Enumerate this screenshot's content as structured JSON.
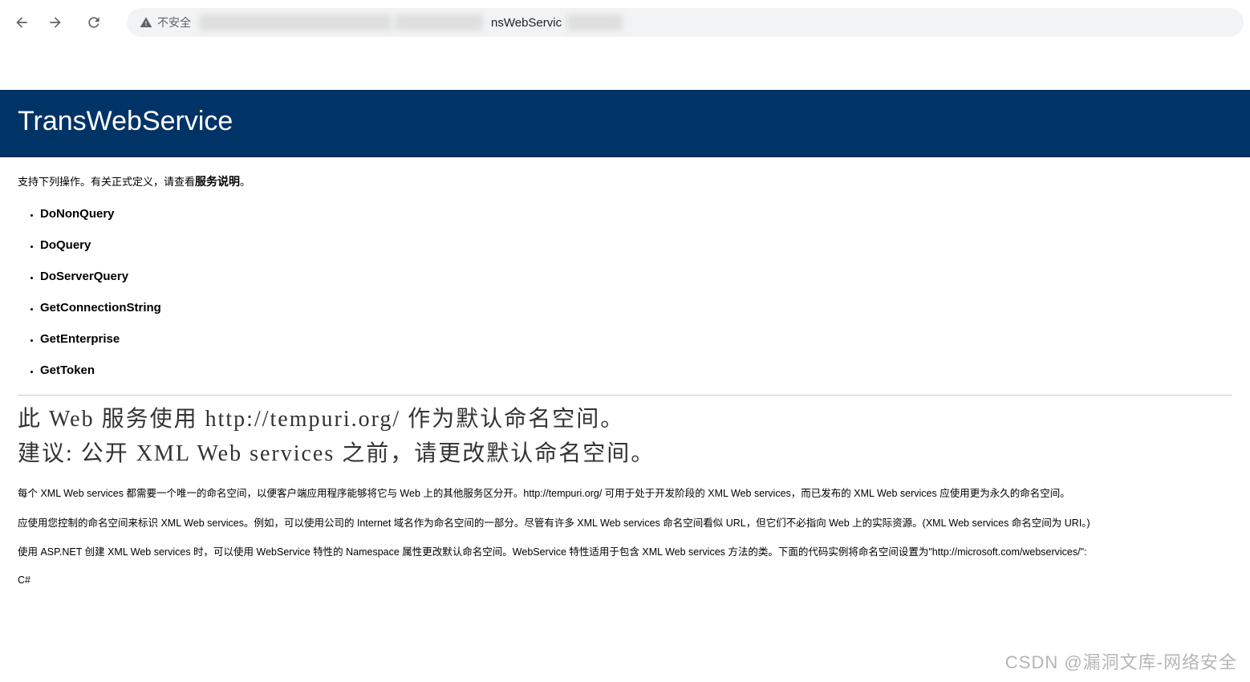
{
  "browser": {
    "security_label": "不安全",
    "url_visible_part": "nsWebServic"
  },
  "page": {
    "title": "TransWebService",
    "intro_prefix": "支持下列操作。有关正式定义，请查看",
    "intro_bold": "服务说明",
    "intro_suffix": "。",
    "operations": [
      "DoNonQuery",
      "DoQuery",
      "DoServerQuery",
      "GetConnectionString",
      "GetEnterprise",
      "GetToken"
    ],
    "big_line_1": "此 Web 服务使用 http://tempuri.org/ 作为默认命名空间。",
    "big_line_2": "建议: 公开 XML Web services 之前，请更改默认命名空间。",
    "desc_1": "每个 XML Web services 都需要一个唯一的命名空间，以便客户端应用程序能够将它与 Web 上的其他服务区分开。http://tempuri.org/ 可用于处于开发阶段的 XML Web services，而已发布的 XML Web services 应使用更为永久的命名空间。",
    "desc_2": "应使用您控制的命名空间来标识 XML Web services。例如，可以使用公司的 Internet 域名作为命名空间的一部分。尽管有许多 XML Web services 命名空间看似 URL，但它们不必指向 Web 上的实际资源。(XML Web services 命名空间为 URI。)",
    "desc_3": "使用 ASP.NET 创建 XML Web services 时，可以使用 WebService 特性的 Namespace 属性更改默认命名空间。WebService 特性适用于包含 XML Web services 方法的类。下面的代码实例将命名空间设置为\"http://microsoft.com/webservices/\":",
    "lang_label": "C#"
  },
  "watermark": "CSDN @漏洞文库-网络安全"
}
